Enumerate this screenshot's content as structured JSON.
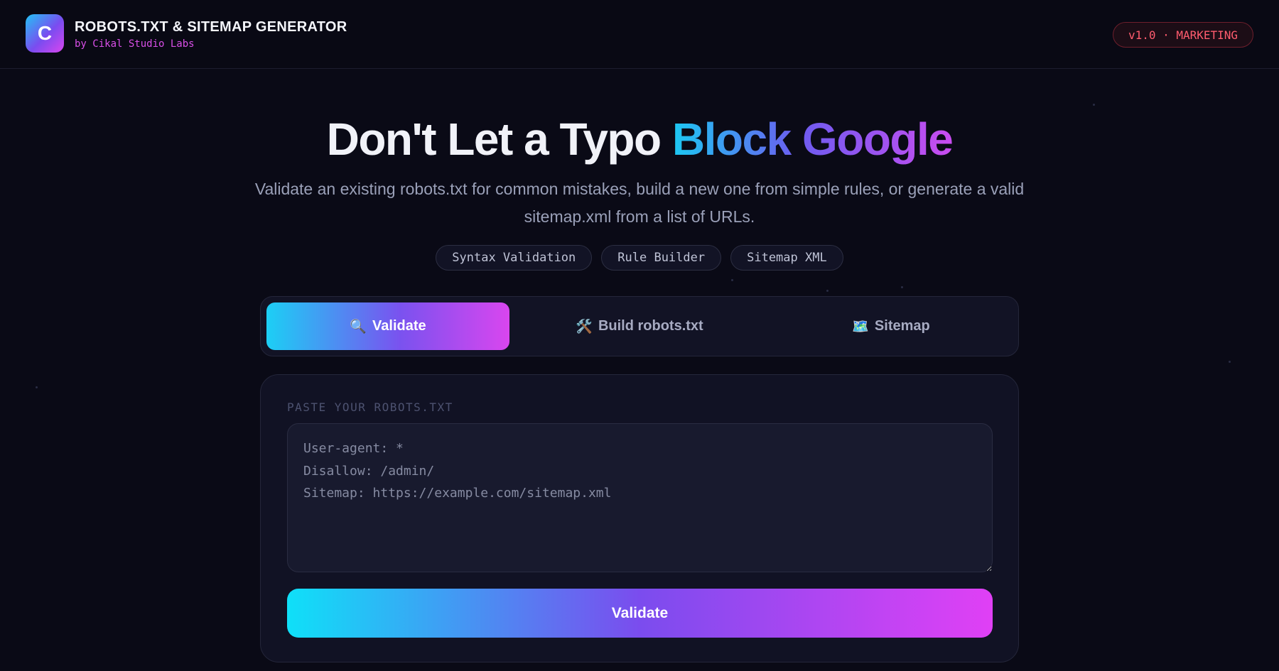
{
  "header": {
    "logo_letter": "C",
    "title": "ROBOTS.TXT & SITEMAP GENERATOR",
    "subtitle": "by Cikal Studio Labs",
    "version_badge": "v1.0 · MARKETING"
  },
  "hero": {
    "title_plain": "Don't Let a Typo ",
    "title_highlight": "Block Google",
    "description": "Validate an existing robots.txt for common mistakes, build a new one from simple rules, or generate a valid sitemap.xml from a list of URLs."
  },
  "features": [
    "Syntax Validation",
    "Rule Builder",
    "Sitemap XML"
  ],
  "tabs": [
    {
      "label": "Validate",
      "icon": "🔍",
      "icon_name": "magnifier-icon",
      "active": true
    },
    {
      "label": "Build robots.txt",
      "icon": "🛠️",
      "icon_name": "tools-icon",
      "active": false
    },
    {
      "label": "Sitemap",
      "icon": "🗺️",
      "icon_name": "map-icon",
      "active": false
    }
  ],
  "validator": {
    "label": "PASTE YOUR ROBOTS.TXT",
    "placeholder": "User-agent: *\nDisallow: /admin/\nSitemap: https://example.com/sitemap.xml",
    "value": "",
    "button_label": "Validate"
  },
  "colors": {
    "background": "#0a0a16",
    "accent_cyan": "#1cc8f2",
    "accent_purple": "#7a52ef",
    "accent_magenta": "#d946ef",
    "badge_red": "#ff5c6e",
    "subtitle_magenta": "#d94fe8"
  }
}
